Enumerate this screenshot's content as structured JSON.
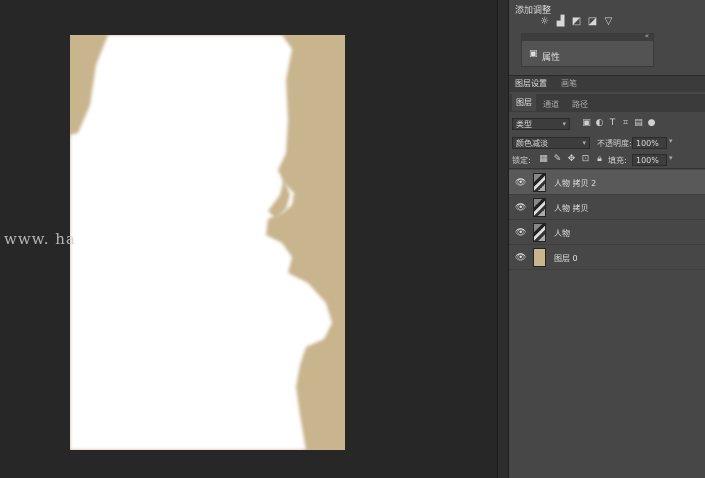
{
  "canvas": {
    "watermark_text": "www. ha",
    "background_color": "#272727",
    "document_fill": "#c8b48d"
  },
  "adjustments": {
    "title": "添加调整",
    "icons": [
      "brightness-icon",
      "levels-icon",
      "curves-icon",
      "exposure-icon",
      "gradient-triangle-icon"
    ]
  },
  "properties": {
    "collapse_glyph": "«",
    "label": "属性"
  },
  "panel_tabs_top": [
    {
      "label": "图层设置",
      "active": true
    },
    {
      "label": "画笔",
      "active": false
    }
  ],
  "panel_tabs": [
    {
      "label": "图层",
      "active": true
    },
    {
      "label": "通道",
      "active": false
    },
    {
      "label": "路径",
      "active": false
    }
  ],
  "filter": {
    "kind_value": "类型",
    "icons": [
      "image-filter-icon",
      "adjustment-filter-icon",
      "type-filter-icon",
      "shape-filter-icon",
      "smart-object-filter-icon",
      "toggle-filter-icon"
    ]
  },
  "blend": {
    "mode_value": "颜色减淡",
    "opacity_label": "不透明度:",
    "opacity_value": "100%"
  },
  "lock": {
    "label": "锁定:",
    "icons": [
      "lock-transparent-icon",
      "lock-brush-icon",
      "lock-move-icon",
      "lock-artboard-icon",
      "lock-all-icon"
    ],
    "fill_label": "填充:",
    "fill_value": "100%"
  },
  "layers": [
    {
      "name": "人物 拷贝 2",
      "thumb": "figure",
      "selected": true
    },
    {
      "name": "人物 拷贝",
      "thumb": "figure",
      "selected": false
    },
    {
      "name": "人物",
      "thumb": "figure",
      "selected": false
    },
    {
      "name": "图层 0",
      "thumb": "solid",
      "selected": false
    }
  ]
}
